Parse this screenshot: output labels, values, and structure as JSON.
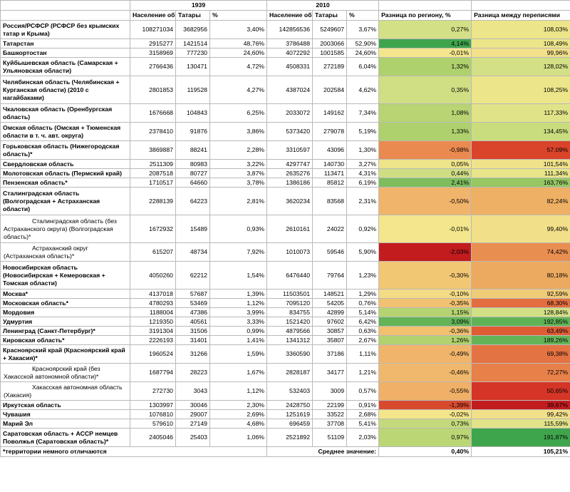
{
  "years": {
    "y1939": "1939",
    "y2010": "2010"
  },
  "headers": {
    "pop_total": "Население общее",
    "tatars": "Татары",
    "pct": "%",
    "diff_region": "Разница по региону, %",
    "diff_census": "Разница между переписями"
  },
  "rows": [
    {
      "name": "Россия/РСФСР (РСФСР без крымских татар и Крыма)",
      "p39": "108271034",
      "t39": "3682956",
      "pc39": "3,40%",
      "p10": "142856536",
      "t10": "5249607",
      "pc10": "3,67%",
      "dr": "0,27%",
      "dc": "108,03%",
      "bold": true,
      "sub": false,
      "h": 26,
      "drColor": "#d3e086",
      "dcColor": "#ece58a"
    },
    {
      "name": "Татарстан",
      "p39": "2915277",
      "t39": "1421514",
      "pc39": "48,76%",
      "p10": "3786488",
      "t10": "2003066",
      "pc10": "52,90%",
      "dr": "4,14%",
      "dc": "108,49%",
      "bold": true,
      "sub": false,
      "h": 13,
      "drColor": "#3fa54d",
      "dcColor": "#ece58a"
    },
    {
      "name": "Башкортостан",
      "p39": "3158969",
      "t39": "777230",
      "pc39": "24,60%",
      "p10": "4072292",
      "t10": "1001585",
      "pc10": "24,60%",
      "dr": "-0,01%",
      "dc": "99,96%",
      "bold": true,
      "sub": false,
      "h": 13,
      "drColor": "#f4e68c",
      "dcColor": "#f2e08a"
    },
    {
      "name": "Куйбышевская область (Самарская + Ульяновская области)",
      "p39": "2766436",
      "t39": "130471",
      "pc39": "4,72%",
      "p10": "4508331",
      "t10": "272189",
      "pc10": "6,04%",
      "dr": "1,32%",
      "dc": "128,02%",
      "bold": true,
      "sub": false,
      "h": 26,
      "drColor": "#afd16d",
      "dcColor": "#d3e086"
    },
    {
      "name": "Челябинская область (Челябинская + Курганская области) (2010 с нагайбаками)",
      "p39": "2801853",
      "t39": "119528",
      "pc39": "4,27%",
      "p10": "4387024",
      "t10": "202584",
      "pc10": "4,62%",
      "dr": "0,35%",
      "dc": "108,25%",
      "bold": true,
      "sub": false,
      "h": 39,
      "drColor": "#d0de84",
      "dcColor": "#ece58a"
    },
    {
      "name": "Чкаловская область (Оренбургская область)",
      "p39": "1676668",
      "t39": "104843",
      "pc39": "6,25%",
      "p10": "2033072",
      "t10": "149162",
      "pc10": "7,34%",
      "dr": "1,08%",
      "dc": "117,33%",
      "bold": true,
      "sub": false,
      "h": 26,
      "drColor": "#b8d473",
      "dcColor": "#e0e388"
    },
    {
      "name": "Омская область (Омская + Тюменская области в т. ч. авт. округа)",
      "p39": "2378410",
      "t39": "91876",
      "pc39": "3,86%",
      "p10": "5373420",
      "t10": "279078",
      "pc10": "5,19%",
      "dr": "1,33%",
      "dc": "134,45%",
      "bold": true,
      "sub": false,
      "h": 26,
      "drColor": "#afd16d",
      "dcColor": "#cadd7e"
    },
    {
      "name": "Горьковская область (Нижегородская область)*",
      "p39": "3869887",
      "t39": "88241",
      "pc39": "2,28%",
      "p10": "3310597",
      "t10": "43096",
      "pc10": "1,30%",
      "dr": "-0,98%",
      "dc": "57,09%",
      "bold": true,
      "sub": false,
      "h": 26,
      "drColor": "#eb8a50",
      "dcColor": "#d9442b"
    },
    {
      "name": "Свердловская область",
      "p39": "2511309",
      "t39": "80983",
      "pc39": "3,22%",
      "p10": "4297747",
      "t10": "140730",
      "pc10": "3,27%",
      "dr": "0,05%",
      "dc": "101,54%",
      "bold": true,
      "sub": false,
      "h": 13,
      "drColor": "#eee48a",
      "dcColor": "#f0e28a"
    },
    {
      "name": "Молотовская область (Пермский край)",
      "p39": "2087518",
      "t39": "80727",
      "pc39": "3,87%",
      "p10": "2635276",
      "t10": "113471",
      "pc10": "4,31%",
      "dr": "0,44%",
      "dc": "111,34%",
      "bold": true,
      "sub": false,
      "h": 13,
      "drColor": "#cfdd83",
      "dcColor": "#e7e489"
    },
    {
      "name": "Пензенская область*",
      "p39": "1710517",
      "t39": "64660",
      "pc39": "3,78%",
      "p10": "1386186",
      "t10": "85812",
      "pc10": "6,19%",
      "dr": "2,41%",
      "dc": "163,76%",
      "bold": true,
      "sub": false,
      "h": 13,
      "drColor": "#7dbd5e",
      "dcColor": "#96c763"
    },
    {
      "name": "Сталинградская область (Волгоградская + Астраханская области)",
      "p39": "2288139",
      "t39": "64223",
      "pc39": "2,81%",
      "p10": "3620234",
      "t10": "83568",
      "pc10": "2,31%",
      "dr": "-0,50%",
      "dc": "82,24%",
      "bold": true,
      "sub": false,
      "h": 39,
      "drColor": "#f0b46b",
      "dcColor": "#eeb064"
    },
    {
      "name": "Сталинградская область (без Астраханского округа) (Волгоградская область)*",
      "p39": "1672932",
      "t39": "15489",
      "pc39": "0,93%",
      "p10": "2610161",
      "t10": "24022",
      "pc10": "0,92%",
      "dr": "-0,01%",
      "dc": "99,40%",
      "bold": false,
      "sub": true,
      "h": 39,
      "drColor": "#f4e68c",
      "dcColor": "#f2df89"
    },
    {
      "name": "Астраханский округ (Астраханская область)*",
      "p39": "615207",
      "t39": "48734",
      "pc39": "7,92%",
      "p10": "1010073",
      "t10": "59546",
      "pc10": "5,90%",
      "dr": "-2,03%",
      "dc": "74,42%",
      "bold": false,
      "sub": true,
      "h": 26,
      "drColor": "#c21c1f",
      "dcColor": "#e98e51"
    },
    {
      "name": "Новосибирская область (Новосибирская + Кемеровская + Томская области)",
      "p39": "4050260",
      "t39": "62212",
      "pc39": "1,54%",
      "p10": "6476440",
      "t10": "79764",
      "pc10": "1,23%",
      "dr": "-0,30%",
      "dc": "80,18%",
      "bold": true,
      "sub": false,
      "h": 39,
      "drColor": "#f2c774",
      "dcColor": "#ecaa60"
    },
    {
      "name": "Москва*",
      "p39": "4137018",
      "t39": "57687",
      "pc39": "1,39%",
      "p10": "11503501",
      "t10": "148521",
      "pc10": "1,29%",
      "dr": "-0,10%",
      "dc": "92,59%",
      "bold": true,
      "sub": false,
      "h": 13,
      "drColor": "#f4db85",
      "dcColor": "#f0cc78"
    },
    {
      "name": "Московская область*",
      "p39": "4780293",
      "t39": "53469",
      "pc39": "1,12%",
      "p10": "7095120",
      "t10": "54205",
      "pc10": "0,76%",
      "dr": "-0,35%",
      "dc": "68,30%",
      "bold": true,
      "sub": false,
      "h": 13,
      "drColor": "#f1c271",
      "dcColor": "#e36e3f"
    },
    {
      "name": "Мордовия",
      "p39": "1188004",
      "t39": "47386",
      "pc39": "3,99%",
      "p10": "834755",
      "t10": "42899",
      "pc10": "5,14%",
      "dr": "1,15%",
      "dc": "128,84%",
      "bold": true,
      "sub": false,
      "h": 13,
      "drColor": "#b5d371",
      "dcColor": "#d2df85"
    },
    {
      "name": "Удмуртия",
      "p39": "1219350",
      "t39": "40561",
      "pc39": "3,33%",
      "p10": "1521420",
      "t10": "97602",
      "pc10": "6,42%",
      "dr": "3,09%",
      "dc": "192,85%",
      "bold": true,
      "sub": false,
      "h": 13,
      "drColor": "#62b457",
      "dcColor": "#5fb356"
    },
    {
      "name": "Ленинград (Санкт-Петербург)*",
      "p39": "3191304",
      "t39": "31506",
      "pc39": "0,99%",
      "p10": "4879566",
      "t10": "30857",
      "pc10": "0,63%",
      "dr": "-0,36%",
      "dc": "63,49%",
      "bold": true,
      "sub": false,
      "h": 13,
      "drColor": "#f1c170",
      "dcColor": "#df5c35"
    },
    {
      "name": "Кировская область*",
      "p39": "2226193",
      "t39": "31401",
      "pc39": "1,41%",
      "p10": "1341312",
      "t10": "35807",
      "pc10": "2,67%",
      "dr": "1,26%",
      "dc": "189,26%",
      "bold": true,
      "sub": false,
      "h": 13,
      "drColor": "#b1d26e",
      "dcColor": "#64b457"
    },
    {
      "name": "Красноярский край (Красноярский край + Хакасия)*",
      "p39": "1960524",
      "t39": "31266",
      "pc39": "1,59%",
      "p10": "3360590",
      "t10": "37186",
      "pc10": "1,11%",
      "dr": "-0,49%",
      "dc": "69,38%",
      "bold": true,
      "sub": false,
      "h": 26,
      "drColor": "#f0b56b",
      "dcColor": "#e47343"
    },
    {
      "name": "Красноярский край (без Хакасской автономной области)*",
      "p39": "1687794",
      "t39": "28223",
      "pc39": "1,67%",
      "p10": "2828187",
      "t10": "34177",
      "pc10": "1,21%",
      "dr": "-0,46%",
      "dc": "72,27%",
      "bold": false,
      "sub": true,
      "h": 26,
      "drColor": "#f0b86d",
      "dcColor": "#e78049"
    },
    {
      "name": "Хакасская автономная область (Хакасия)",
      "p39": "272730",
      "t39": "3043",
      "pc39": "1,12%",
      "p10": "532403",
      "t10": "3009",
      "pc10": "0,57%",
      "dr": "-0,55%",
      "dc": "50,65%",
      "bold": false,
      "sub": true,
      "h": 26,
      "drColor": "#f0b068",
      "dcColor": "#d53526"
    },
    {
      "name": "Иркутская область",
      "p39": "1303997",
      "t39": "30046",
      "pc39": "2,30%",
      "p10": "2428750",
      "t10": "22199",
      "pc10": "0,91%",
      "dr": "-1,39%",
      "dc": "39,67%",
      "bold": true,
      "sub": false,
      "h": 13,
      "drColor": "#d84a2e",
      "dcColor": "#c21c1f"
    },
    {
      "name": "Чувашия",
      "p39": "1076810",
      "t39": "29007",
      "pc39": "2,69%",
      "p10": "1251619",
      "t10": "33522",
      "pc10": "2,68%",
      "dr": "-0,02%",
      "dc": "99,42%",
      "bold": true,
      "sub": false,
      "h": 13,
      "drColor": "#f4e58b",
      "dcColor": "#f2df89"
    },
    {
      "name": "Марий Эл",
      "p39": "579610",
      "t39": "27149",
      "pc39": "4,68%",
      "p10": "696459",
      "t10": "37708",
      "pc10": "5,41%",
      "dr": "0,73%",
      "dc": "115,59%",
      "bold": true,
      "sub": false,
      "h": 13,
      "drColor": "#c4d97b",
      "dcColor": "#e2e388"
    },
    {
      "name": "Саратовская область + АССР немцев Поволжья (Саратовская область)*",
      "p39": "2405046",
      "t39": "25403",
      "pc39": "1,06%",
      "p10": "2521892",
      "t10": "51109",
      "pc10": "2,03%",
      "dr": "0,97%",
      "dc": "191,87%",
      "bold": true,
      "sub": false,
      "h": 26,
      "drColor": "#bbd675",
      "dcColor": "#3fa54d"
    }
  ],
  "footer": {
    "note": "*территории немного отличаются",
    "avg_label": "Среднее значение:",
    "avg_region": "0,40%",
    "avg_census": "105,21%"
  }
}
